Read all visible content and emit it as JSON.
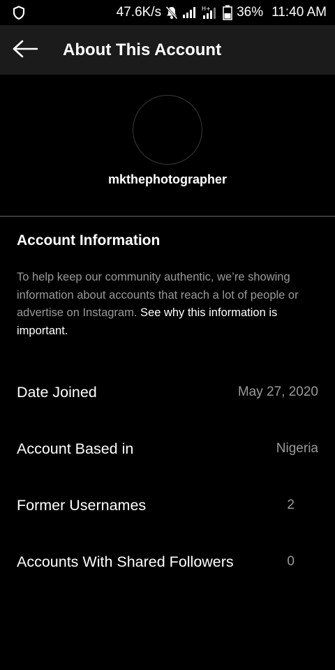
{
  "status_bar": {
    "speed": "47.6K/s",
    "battery": "36%",
    "time": "11:40 AM",
    "icons": [
      "shield-icon",
      "mute-icon",
      "signal-icon",
      "hplus-signal-icon",
      "battery-icon"
    ]
  },
  "app_bar": {
    "back_icon": "arrow-left-icon",
    "title": "About This Account"
  },
  "profile": {
    "username": "mkthephotographer"
  },
  "account_info": {
    "title": "Account Information",
    "description": "To help keep our community authentic, we’re showing information about accounts that reach a lot of people or advertise on Instagram. ",
    "link_text": "See why this information is important."
  },
  "details": [
    {
      "label": "Date Joined",
      "value": "May 27, 2020"
    },
    {
      "label": "Account Based in",
      "value": "Nigeria"
    },
    {
      "label": "Former Usernames",
      "value": "2"
    },
    {
      "label": "Accounts With Shared Followers",
      "value": "0"
    }
  ],
  "colors": {
    "background": "#000000",
    "app_bar": "#1b1b1b",
    "secondary_text": "#9a9a9a",
    "divider": "#3a3a3a"
  }
}
